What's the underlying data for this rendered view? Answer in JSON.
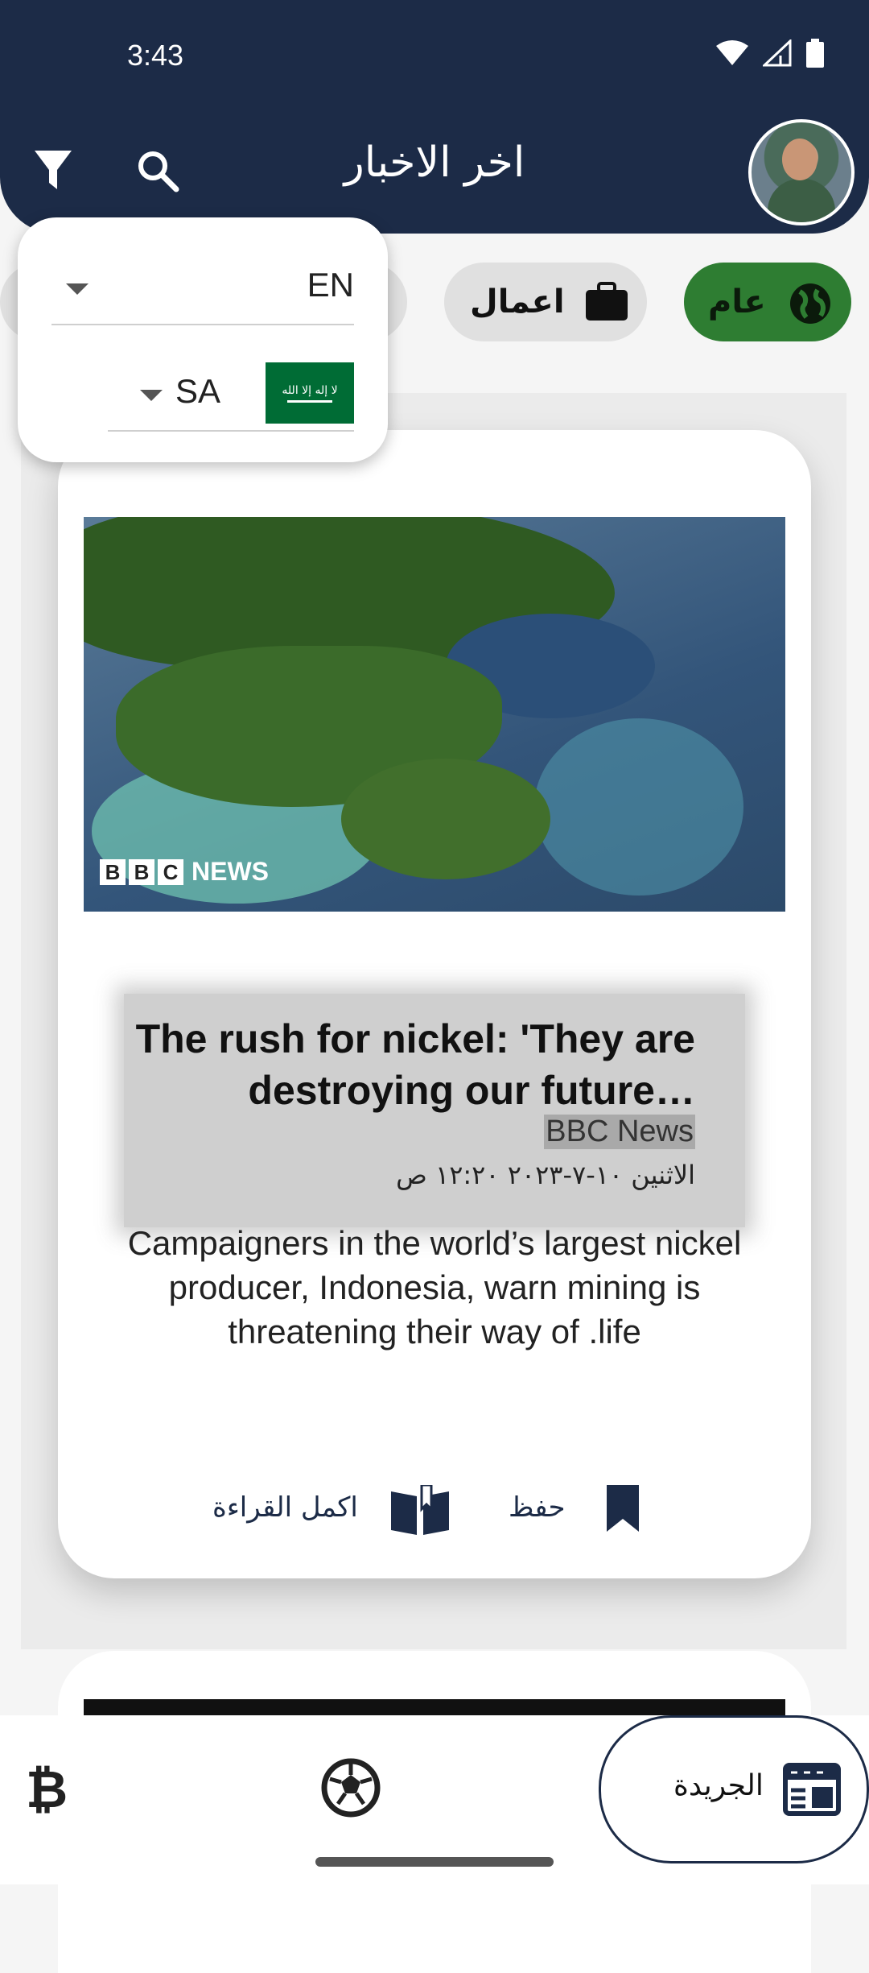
{
  "status_bar": {
    "time": "3:43"
  },
  "header": {
    "title": "اخر الاخبار"
  },
  "categories": [
    {
      "label": "عام",
      "icon": "globe-icon",
      "selected": true
    },
    {
      "label": "اعمال",
      "icon": "briefcase-icon",
      "selected": false
    }
  ],
  "language_popup": {
    "language_value": "EN",
    "country_value": "SA",
    "flag": "saudi-arabia-flag",
    "flag_script": "لا إله إلا الله"
  },
  "article": {
    "image_source_logo": {
      "letters": [
        "B",
        "B",
        "C"
      ],
      "word": "NEWS"
    },
    "title": "The rush for nickel: 'They are destroying our future…",
    "source": "BBC News",
    "date": "الاثنين ١٠-٧-٢٠٢٣ ١٢:٢٠ ص",
    "description": "Campaigners in the world’s largest nickel producer, Indonesia, warn mining is threatening their way of .life",
    "read_more_label": "اكمل القراءة",
    "save_label": "حفظ"
  },
  "bottom_nav": {
    "newspaper_label": "الجريدة",
    "items": [
      "bitcoin-icon",
      "soccer-ball-icon",
      "newspaper-icon"
    ]
  },
  "colors": {
    "header_bg": "#1c2b47",
    "selected_chip": "#2e7d32",
    "chip_bg": "#e0e0e0"
  }
}
